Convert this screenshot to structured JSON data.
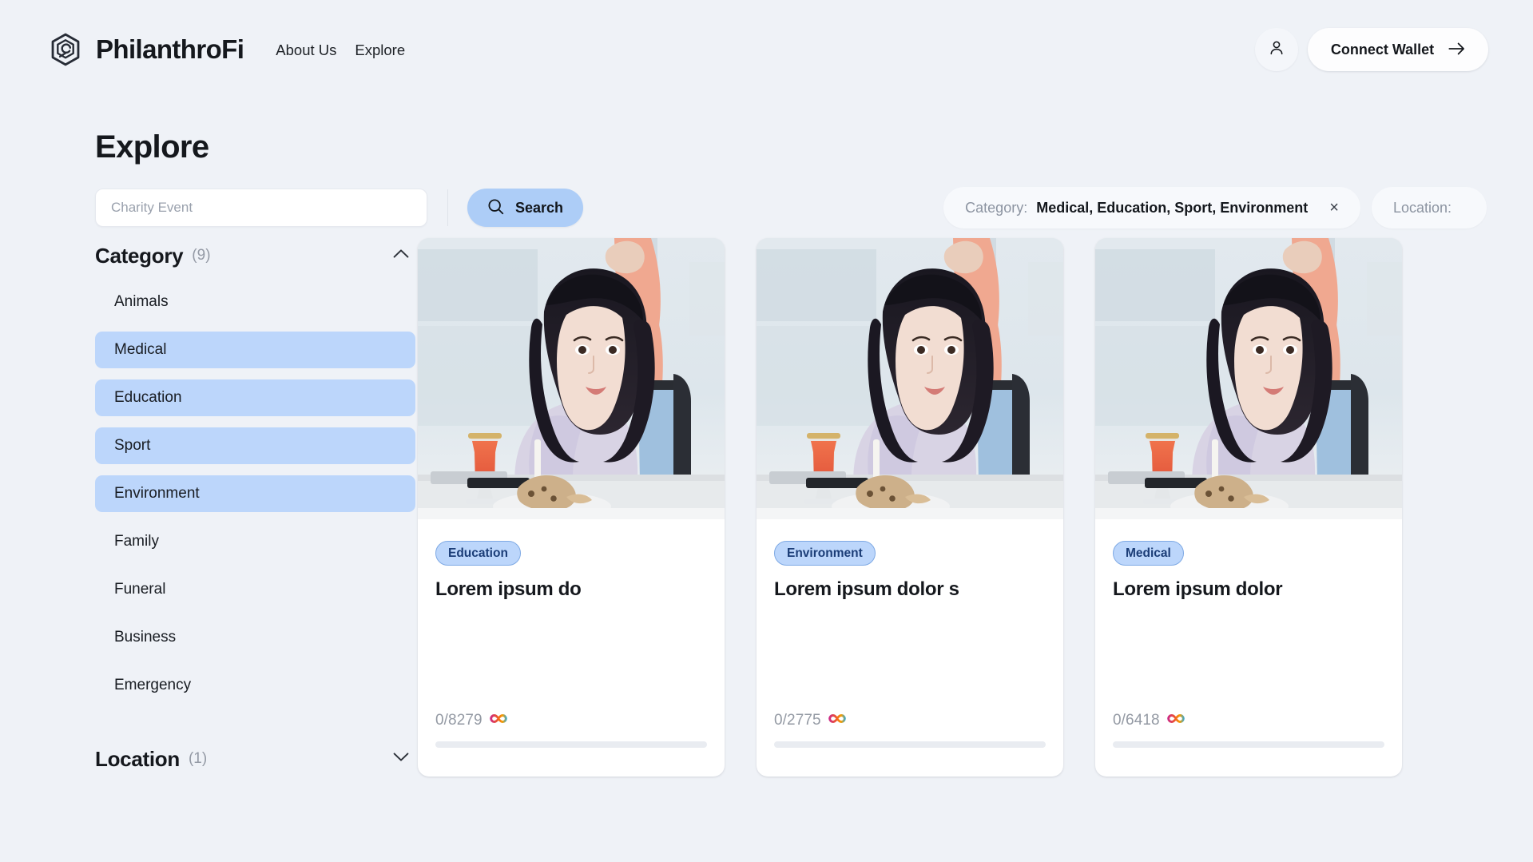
{
  "brand": {
    "name": "PhilanthroFi",
    "logo_icon": "hexagon-spiral-logo-icon"
  },
  "nav": {
    "items": [
      {
        "label": "About Us"
      },
      {
        "label": "Explore"
      }
    ]
  },
  "header": {
    "account_icon": "person-icon",
    "connect_label": "Connect Wallet",
    "connect_arrow_icon": "arrow-right-icon"
  },
  "page": {
    "title": "Explore"
  },
  "search": {
    "placeholder": "Charity Event",
    "value": "",
    "button_label": "Search",
    "button_icon": "search-icon",
    "button_color": "#adcdf7"
  },
  "chips": [
    {
      "key": "Category:",
      "value": "Medical,  Education,  Sport,  Environment",
      "clear_icon": "close-icon",
      "clear_glyph": "×",
      "has_clear": true
    },
    {
      "key": "Location:",
      "value": "",
      "has_clear": false
    }
  ],
  "facets": [
    {
      "title": "Category",
      "count": "(9)",
      "expanded": true,
      "caret_icon": "chevron-up-icon",
      "items": [
        {
          "label": "Animals",
          "selected": false
        },
        {
          "label": "Medical",
          "selected": true
        },
        {
          "label": "Education",
          "selected": true
        },
        {
          "label": "Sport",
          "selected": true
        },
        {
          "label": "Environment",
          "selected": true
        },
        {
          "label": "Family",
          "selected": false
        },
        {
          "label": "Funeral",
          "selected": false
        },
        {
          "label": "Business",
          "selected": false
        },
        {
          "label": "Emergency",
          "selected": false
        }
      ]
    },
    {
      "title": "Location",
      "count": "(1)",
      "expanded": false,
      "caret_icon": "chevron-down-icon",
      "items": []
    }
  ],
  "cards": [
    {
      "tag": "Education",
      "title": "Lorem ipsum do",
      "amount": "0/8279",
      "currency_icon": "internet-computer-infinity-icon",
      "progress_percent": 0,
      "image_alt": "woman-seated-at-cafe-table-photo"
    },
    {
      "tag": "Environment",
      "title": "Lorem ipsum dolor s",
      "amount": "0/2775",
      "currency_icon": "internet-computer-infinity-icon",
      "progress_percent": 0,
      "image_alt": "woman-seated-at-cafe-table-photo"
    },
    {
      "tag": "Medical",
      "title": "Lorem ipsum dolor",
      "amount": "0/6418",
      "currency_icon": "internet-computer-infinity-icon",
      "progress_percent": 0,
      "image_alt": "woman-seated-at-cafe-table-photo"
    }
  ],
  "colors": {
    "page_background": "#eff2f7",
    "accent_blue": "#bcd6fb",
    "search_button": "#adcdf7",
    "tag_text": "#1b3d77",
    "muted_text": "#9399a3"
  }
}
